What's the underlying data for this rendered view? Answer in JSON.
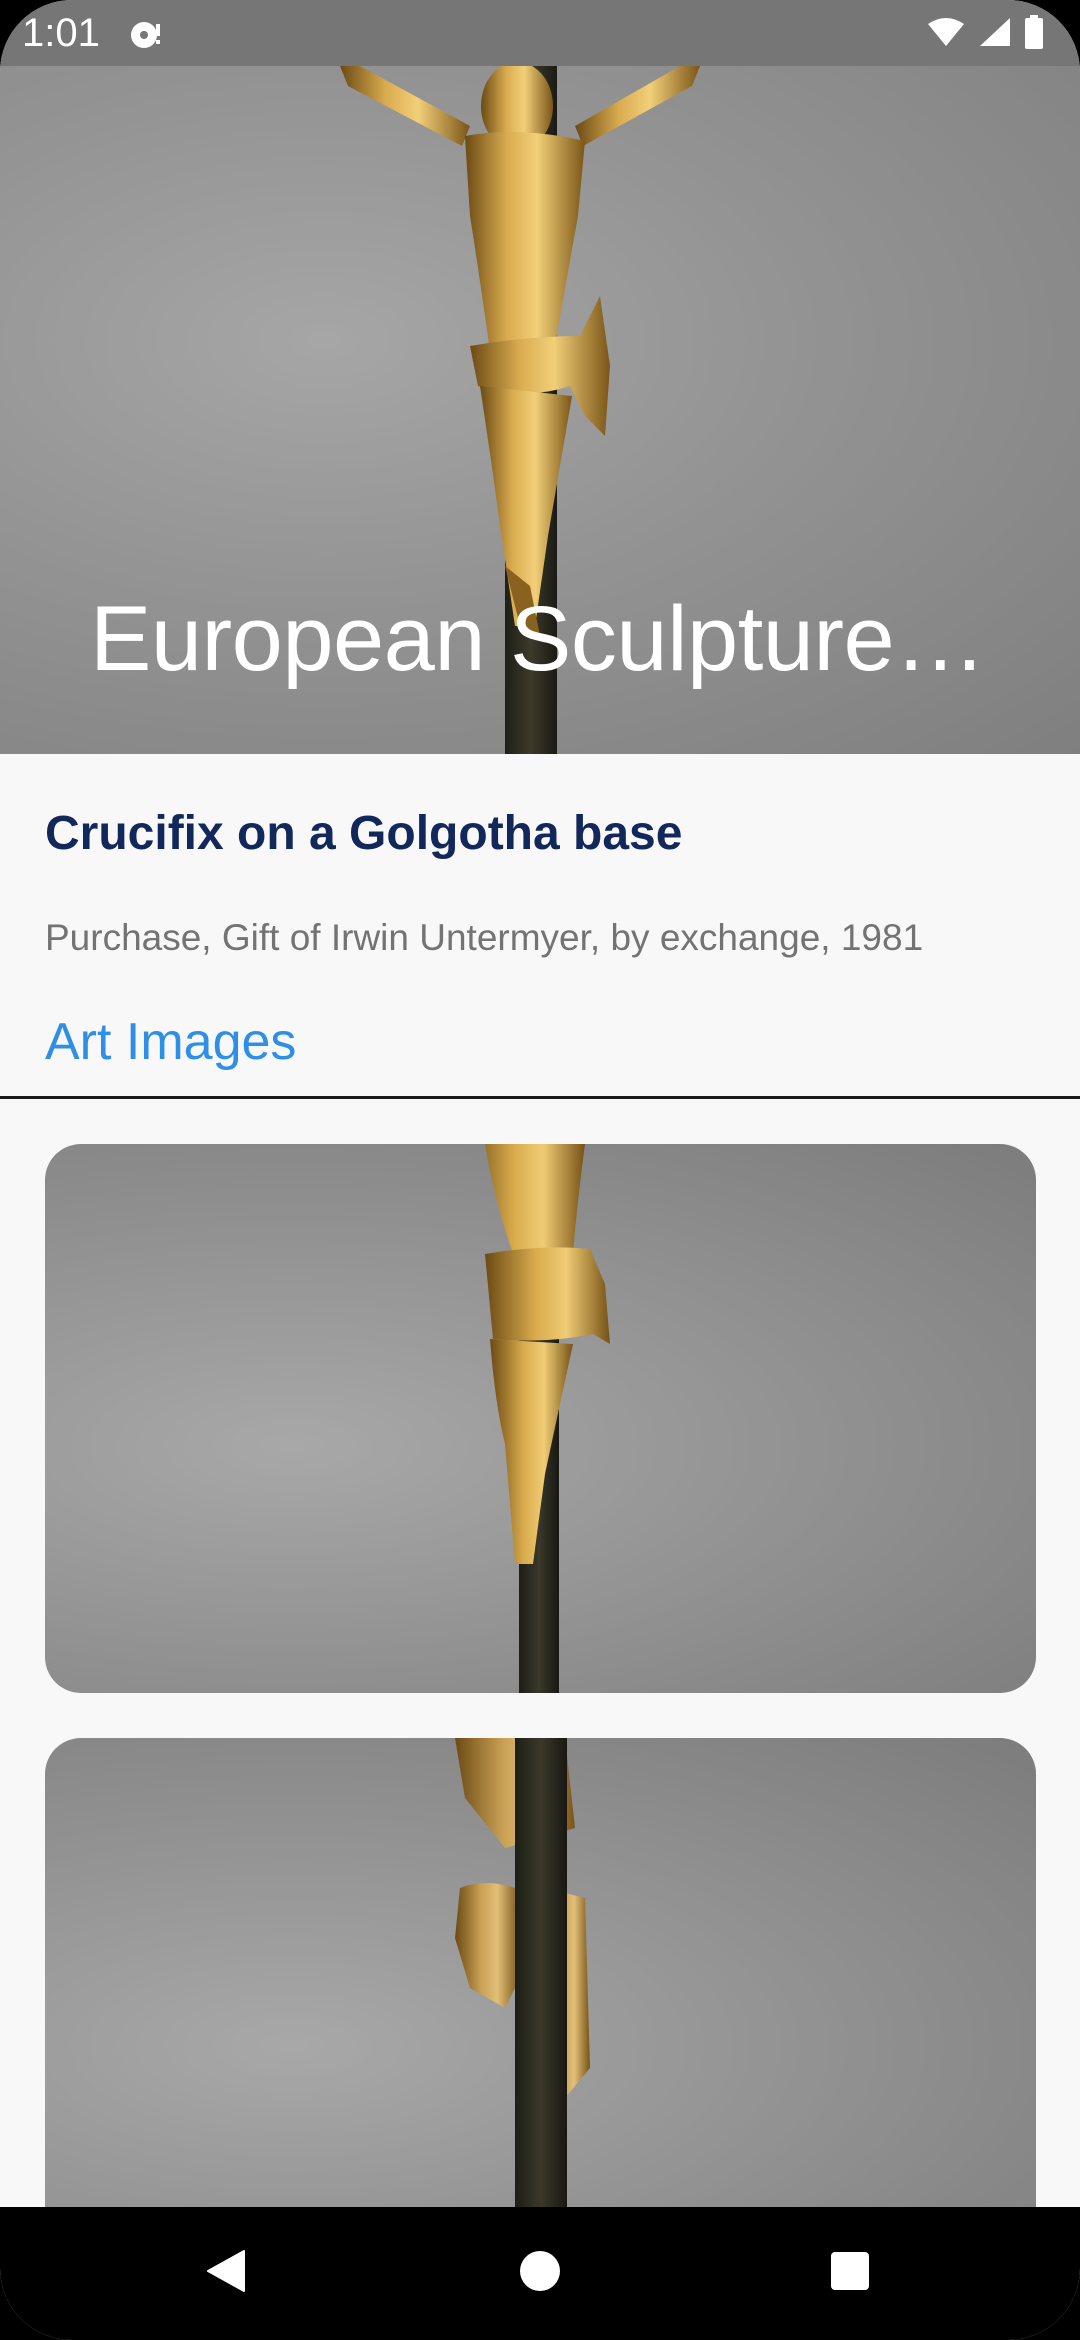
{
  "status_bar": {
    "time": "1:01",
    "icons": [
      "notification-icon",
      "wifi-icon",
      "signal-icon",
      "battery-icon"
    ]
  },
  "hero": {
    "title": "European Sculpture…"
  },
  "artwork": {
    "title": "Crucifix on a Golgotha base",
    "credit_line": "Purchase, Gift of Irwin Untermyer, by exchange, 1981"
  },
  "section": {
    "title": "Art Images"
  },
  "images": [
    {
      "name": "artwork-image-1"
    },
    {
      "name": "artwork-image-2"
    }
  ],
  "navigation": {
    "items": [
      "back-icon",
      "home-icon",
      "recents-icon"
    ]
  },
  "colors": {
    "status_bar": "#767676",
    "title": "#13285a",
    "credit": "#737373",
    "section_title": "#2f8fe6",
    "background": "#f8f8f8",
    "nav_bar": "#000000"
  }
}
